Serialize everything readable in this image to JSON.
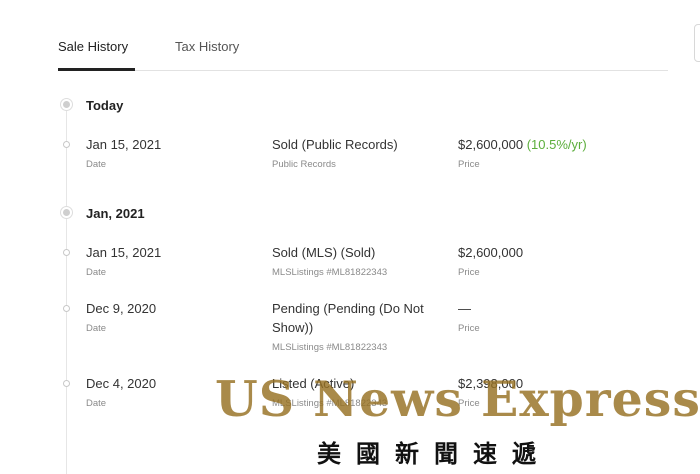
{
  "tabs": [
    {
      "label": "Sale History",
      "active": true
    },
    {
      "label": "Tax History",
      "active": false
    }
  ],
  "groups": [
    {
      "label": "Today"
    },
    {
      "label": "Jan, 2021"
    }
  ],
  "events": [
    {
      "date": "Jan 15, 2021",
      "date_label": "Date",
      "event": "Sold (Public Records)",
      "source": "Public Records",
      "price": "$2,600,000",
      "change": "(10.5%/yr)",
      "price_label": "Price"
    },
    {
      "date": "Jan 15, 2021",
      "date_label": "Date",
      "event": "Sold (MLS) (Sold)",
      "source": "MLSListings #ML81822343",
      "price": "$2,600,000",
      "change": "",
      "price_label": "Price"
    },
    {
      "date": "Dec 9, 2020",
      "date_label": "Date",
      "event": "Pending (Pending (Do Not Show))",
      "source": "MLSListings #ML81822343",
      "price": "—",
      "change": "",
      "price_label": "Price"
    },
    {
      "date": "Dec 4, 2020",
      "date_label": "Date",
      "event": "Listed (Active)",
      "source": "MLSListings #ML81822343",
      "price": "$2,398,000",
      "change": "",
      "price_label": "Price"
    }
  ],
  "watermark": {
    "title": "US News Express",
    "subtitle": "美國新聞速遞"
  },
  "colors": {
    "accent_green": "#5cae3c",
    "tab_underline": "#222222",
    "watermark_gold": "#967022"
  }
}
